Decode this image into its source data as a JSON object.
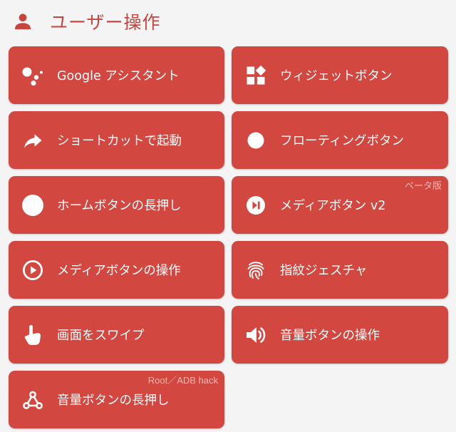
{
  "header": {
    "title": "ユーザー操作",
    "icon": "person-icon",
    "accent": "#c8453f"
  },
  "colors": {
    "card": "#d2473f",
    "text": "#ffffff",
    "badge_text": "#f3b8b3",
    "background": "#f4f4f4"
  },
  "buttons": [
    {
      "label": "Google アシスタント",
      "icon": "google-assistant-icon"
    },
    {
      "label": "ウィジェットボタン",
      "icon": "widgets-icon"
    },
    {
      "label": "ショートカットで起動",
      "icon": "share-arrow-icon"
    },
    {
      "label": "フローティングボタン",
      "icon": "circle-icon"
    },
    {
      "label": "ホームボタンの長押し",
      "icon": "home-circle-icon"
    },
    {
      "label": "メディアボタン v2",
      "icon": "play-pause-icon",
      "badge": "ベータ版"
    },
    {
      "label": "メディアボタンの操作",
      "icon": "play-circle-icon"
    },
    {
      "label": "指紋ジェスチャ",
      "icon": "fingerprint-icon"
    },
    {
      "label": "画面をスワイプ",
      "icon": "touch-hand-icon"
    },
    {
      "label": "音量ボタンの操作",
      "icon": "volume-icon"
    },
    {
      "label": "音量ボタンの長押し",
      "icon": "webhook-icon",
      "badge": "Root／ADB hack"
    }
  ]
}
